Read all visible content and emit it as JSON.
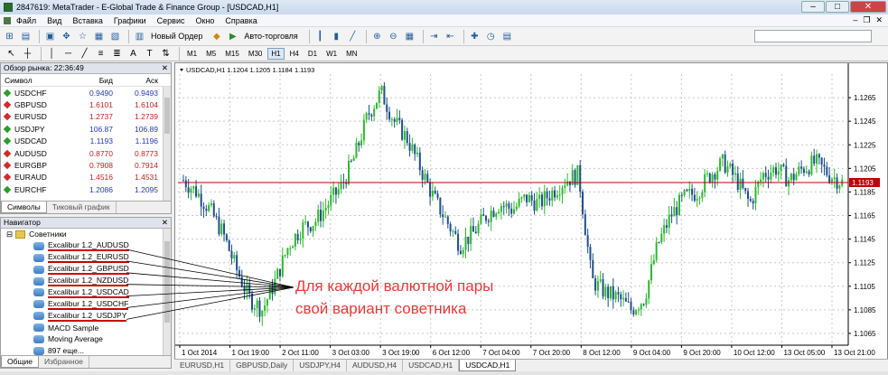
{
  "window": {
    "title": "2847619: MetaTrader - E-Global Trade & Finance Group - [USDCAD,H1]"
  },
  "menu": [
    "Файл",
    "Вид",
    "Вставка",
    "Графики",
    "Сервис",
    "Окно",
    "Справка"
  ],
  "toolbar": {
    "new_order": "Новый Ордер",
    "autotrade": "Авто-торговля"
  },
  "timeframes": [
    "M1",
    "M5",
    "M15",
    "M30",
    "H1",
    "H4",
    "D1",
    "W1",
    "MN"
  ],
  "active_timeframe": "H1",
  "market_watch": {
    "title": "Обзор рынка: 22:36:49",
    "col_symbol": "Символ",
    "col_bid": "Бид",
    "col_ask": "Аск",
    "rows": [
      {
        "s": "USDCHF",
        "b": "0.9490",
        "a": "0.9493",
        "dir": "up"
      },
      {
        "s": "GBPUSD",
        "b": "1.6101",
        "a": "1.6104",
        "dir": "dn"
      },
      {
        "s": "EURUSD",
        "b": "1.2737",
        "a": "1.2739",
        "dir": "dn"
      },
      {
        "s": "USDJPY",
        "b": "106.87",
        "a": "106.89",
        "dir": "up"
      },
      {
        "s": "USDCAD",
        "b": "1.1193",
        "a": "1.1196",
        "dir": "up"
      },
      {
        "s": "AUDUSD",
        "b": "0.8770",
        "a": "0.8773",
        "dir": "dn"
      },
      {
        "s": "EURGBP",
        "b": "0.7908",
        "a": "0.7914",
        "dir": "dn"
      },
      {
        "s": "EURAUD",
        "b": "1.4516",
        "a": "1.4531",
        "dir": "dn"
      },
      {
        "s": "EURCHF",
        "b": "1.2086",
        "a": "1.2095",
        "dir": "up"
      }
    ],
    "tabs": [
      "Символы",
      "Тиковый график"
    ]
  },
  "navigator": {
    "title": "Навигатор",
    "folder": "Советники",
    "experts": [
      "Excalibur 1.2_AUDUSD",
      "Excalibur 1.2_EURUSD",
      "Excalibur 1.2_GBPUSD",
      "Excalibur 1.2_NZDUSD",
      "Excalibur 1.2_USDCAD",
      "Excalibur 1.2_USDCHF",
      "Excalibur 1.2_USDJPY"
    ],
    "others": [
      "MACD Sample",
      "Moving Average"
    ],
    "more": "897 еще...",
    "tabs": [
      "Общие",
      "Избранное"
    ]
  },
  "chart_data": {
    "type": "candlestick",
    "title": "USDCAD,H1  1.1204 1.1205 1.1184 1.1193",
    "current_price": 1.1193,
    "current_price_label": "1.1193",
    "ylim": [
      1.1055,
      1.1285
    ],
    "yticks": [
      "1.1265",
      "1.1245",
      "1.1225",
      "1.1205",
      "1.1185",
      "1.1165",
      "1.1145",
      "1.1125",
      "1.1105",
      "1.1085",
      "1.1065"
    ],
    "xticks": [
      "1 Oct 2014",
      "1 Oct 19:00",
      "2 Oct 11:00",
      "3 Oct 03:00",
      "3 Oct 19:00",
      "6 Oct 12:00",
      "7 Oct 04:00",
      "7 Oct 20:00",
      "8 Oct 12:00",
      "9 Oct 04:00",
      "9 Oct 20:00",
      "10 Oct 12:00",
      "13 Oct 05:00",
      "13 Oct 21:00"
    ],
    "path": [
      1.1195,
      1.1185,
      1.117,
      1.115,
      1.112,
      1.1095,
      1.1085,
      1.111,
      1.114,
      1.1155,
      1.116,
      1.1175,
      1.119,
      1.1215,
      1.125,
      1.127,
      1.1245,
      1.123,
      1.1205,
      1.118,
      1.116,
      1.114,
      1.115,
      1.1165,
      1.1175,
      1.117,
      1.118,
      1.1175,
      1.1185,
      1.1195,
      1.12,
      1.111,
      1.11,
      1.1095,
      1.1085,
      1.1095,
      1.114,
      1.1165,
      1.118,
      1.1185,
      1.12,
      1.121,
      1.1195,
      1.1175,
      1.12,
      1.1205,
      1.1195,
      1.1205,
      1.121,
      1.12,
      1.1193
    ],
    "annotation": [
      "Для каждой валютной пары",
      "свой вариант советника"
    ],
    "annotation_color": "#e53b3b"
  },
  "chart_tabs": [
    "EURUSD,H1",
    "GBPUSD,Daily",
    "USDJPY,H4",
    "AUDUSD,H4",
    "USDCAD,H1",
    "USDCAD,H1"
  ],
  "active_chart_tab": 5
}
